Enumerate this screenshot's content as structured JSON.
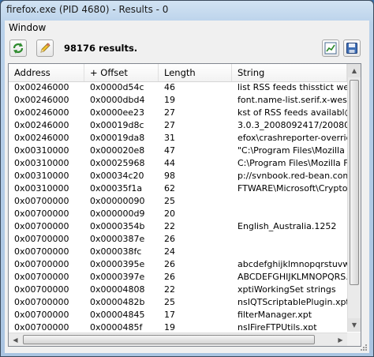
{
  "window": {
    "title": "firefox.exe (PID 4680) - Results - 0"
  },
  "menu": {
    "items": [
      "Window"
    ]
  },
  "toolbar": {
    "results_label": "98176 results."
  },
  "table": {
    "columns": [
      "Address",
      "+ Offset",
      "Length",
      "String"
    ],
    "rows": [
      [
        "0x00246000",
        "0x0000d54c",
        "46",
        "list RSS feeds thisstict week"
      ],
      [
        "0x00246000",
        "0x0000dbd4",
        "19",
        "font.name-list.serif.x-western"
      ],
      [
        "0x00246000",
        "0x0000ee23",
        "27",
        "kst of RSS feeds availabl@?"
      ],
      [
        "0x00246000",
        "0x00019d8c",
        "27",
        "3.0.3_2008092417/2008092"
      ],
      [
        "0x00246000",
        "0x00019da8",
        "31",
        "efox\\crashreporter-override.in"
      ],
      [
        "0x00310000",
        "0x000020e8",
        "47",
        "\"C:\\Program Files\\Mozilla Fir."
      ],
      [
        "0x00310000",
        "0x00025968",
        "44",
        "C:\\Program Files\\Mozilla Firef"
      ],
      [
        "0x00310000",
        "0x00034c20",
        "98",
        "p://svnbook.red-bean.com/e"
      ],
      [
        "0x00310000",
        "0x00035f1a",
        "62",
        "FTWARE\\Microsoft\\Cryptogr"
      ],
      [
        "0x00700000",
        "0x00000090",
        "25",
        ""
      ],
      [
        "0x00700000",
        "0x000000d9",
        "20",
        ""
      ],
      [
        "0x00700000",
        "0x0000354b",
        "22",
        "English_Australia.1252"
      ],
      [
        "0x00700000",
        "0x0000387e",
        "26",
        ""
      ],
      [
        "0x00700000",
        "0x000038fc",
        "24",
        ""
      ],
      [
        "0x00700000",
        "0x0000395e",
        "26",
        "abcdefghijklmnopqrstuvwxyz"
      ],
      [
        "0x00700000",
        "0x0000397e",
        "26",
        "ABCDEFGHIJKLMNOPQRS."
      ],
      [
        "0x00700000",
        "0x00004808",
        "22",
        "xptiWorkingSet strings"
      ],
      [
        "0x00700000",
        "0x0000482b",
        "25",
        "nsIQTScriptablePlugin.xpt"
      ],
      [
        "0x00700000",
        "0x00004845",
        "17",
        "filterManager.xpt"
      ],
      [
        "0x00700000",
        "0x0000485f",
        "19",
        "nsIFireFTPUtils.xpt"
      ]
    ]
  },
  "colors": {
    "accent": "#3a6ea5",
    "grid_bg": "#ffffff"
  },
  "icons": [
    "refresh-icon",
    "pencil-icon",
    "chart-icon",
    "save-icon"
  ]
}
